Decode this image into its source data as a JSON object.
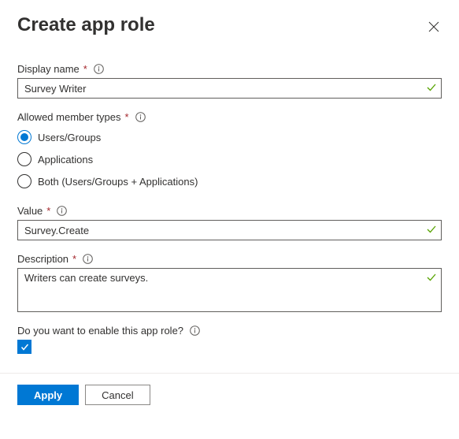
{
  "header": {
    "title": "Create app role"
  },
  "fields": {
    "displayName": {
      "label": "Display name",
      "value": "Survey Writer"
    },
    "memberTypes": {
      "label": "Allowed member types",
      "options": {
        "usersGroups": "Users/Groups",
        "applications": "Applications",
        "both": "Both (Users/Groups + Applications)"
      }
    },
    "value": {
      "label": "Value",
      "value": "Survey.Create"
    },
    "description": {
      "label": "Description",
      "value": "Writers can create surveys."
    },
    "enable": {
      "label": "Do you want to enable this app role?"
    }
  },
  "footer": {
    "apply": "Apply",
    "cancel": "Cancel"
  }
}
